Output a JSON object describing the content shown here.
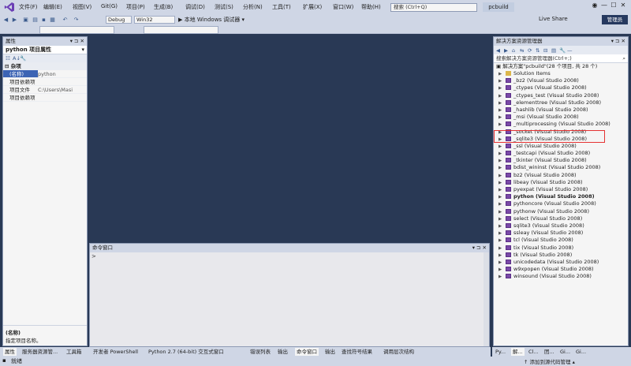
{
  "menubar": {
    "items": [
      "文件(F)",
      "编辑(E)",
      "视图(V)",
      "Git(G)",
      "项目(P)",
      "生成(B)",
      "调试(D)",
      "测试(S)",
      "分析(N)",
      "工具(T)",
      "扩展(X)",
      "窗口(W)",
      "帮助(H)"
    ],
    "search_placeholder": "搜索 (Ctrl+Q)",
    "solution_name": "pcbuild"
  },
  "toolbar": {
    "config": "Debug",
    "platform": "Win32",
    "run_label": "▶ 本地 Windows 调试器 ▾",
    "live_share": "Live Share",
    "admin_badge": "管理员"
  },
  "properties": {
    "title": "属性",
    "object": "python 项目属性",
    "category": "杂项",
    "rows": [
      {
        "key": "(名称)",
        "value": "python"
      },
      {
        "key": "项目依赖项",
        "value": ""
      },
      {
        "key": "项目文件",
        "value": "C:\\Users\\Masi"
      },
      {
        "key": "项目依赖项",
        "value": ""
      }
    ],
    "desc_title": "(名称)",
    "desc_text": "指定项目名称。"
  },
  "command_window": {
    "title": "命令窗口",
    "caret": ">"
  },
  "solution_explorer": {
    "title": "解决方案资源管理器",
    "search_placeholder": "搜索解决方案资源管理器(Ctrl+;)",
    "root": "解决方案\"pcbuild\"(28 个项目, 共 28 个)",
    "items": [
      {
        "label": "Solution Items",
        "kind": "folder",
        "bold": false
      },
      {
        "label": "_bz2 (Visual Studio 2008)",
        "kind": "project",
        "bold": false
      },
      {
        "label": "_ctypes (Visual Studio 2008)",
        "kind": "project",
        "bold": false
      },
      {
        "label": "_ctypes_test (Visual Studio 2008)",
        "kind": "project",
        "bold": false
      },
      {
        "label": "_elementtree (Visual Studio 2008)",
        "kind": "project",
        "bold": false
      },
      {
        "label": "_hashlib (Visual Studio 2008)",
        "kind": "project",
        "bold": false
      },
      {
        "label": "_msi (Visual Studio 2008)",
        "kind": "project",
        "bold": false
      },
      {
        "label": "_multiprocessing (Visual Studio 2008)",
        "kind": "project",
        "bold": false
      },
      {
        "label": "_socket (Visual Studio 2008)",
        "kind": "project",
        "bold": false
      },
      {
        "label": "_sqlite3 (Visual Studio 2008)",
        "kind": "project",
        "bold": false
      },
      {
        "label": "_ssl (Visual Studio 2008)",
        "kind": "project",
        "bold": false
      },
      {
        "label": "_testcapi (Visual Studio 2008)",
        "kind": "project",
        "bold": false
      },
      {
        "label": "_tkinter (Visual Studio 2008)",
        "kind": "project",
        "bold": false
      },
      {
        "label": "bdist_wininst (Visual Studio 2008)",
        "kind": "project",
        "bold": false
      },
      {
        "label": "bz2 (Visual Studio 2008)",
        "kind": "project",
        "bold": false
      },
      {
        "label": "libeay (Visual Studio 2008)",
        "kind": "project",
        "bold": false
      },
      {
        "label": "pyexpat (Visual Studio 2008)",
        "kind": "project",
        "bold": false
      },
      {
        "label": "python (Visual Studio 2008)",
        "kind": "project",
        "bold": true
      },
      {
        "label": "pythoncore (Visual Studio 2008)",
        "kind": "project",
        "bold": false
      },
      {
        "label": "pythonw (Visual Studio 2008)",
        "kind": "project",
        "bold": false
      },
      {
        "label": "select (Visual Studio 2008)",
        "kind": "project",
        "bold": false
      },
      {
        "label": "sqlite3 (Visual Studio 2008)",
        "kind": "project",
        "bold": false
      },
      {
        "label": "ssleay (Visual Studio 2008)",
        "kind": "project",
        "bold": false
      },
      {
        "label": "tcl (Visual Studio 2008)",
        "kind": "project",
        "bold": false
      },
      {
        "label": "tix (Visual Studio 2008)",
        "kind": "project",
        "bold": false
      },
      {
        "label": "tk (Visual Studio 2008)",
        "kind": "project",
        "bold": false
      },
      {
        "label": "unicodedata (Visual Studio 2008)",
        "kind": "project",
        "bold": false
      },
      {
        "label": "w9xpopen (Visual Studio 2008)",
        "kind": "project",
        "bold": false
      },
      {
        "label": "winsound (Visual Studio 2008)",
        "kind": "project",
        "bold": false
      }
    ]
  },
  "bottom_tabs": [
    "属性",
    "服务器资源管...",
    "工具箱",
    "开发者 PowerShell",
    "Python 2.7 (64-bit) 交互式窗口",
    "错误列表",
    "输出",
    "命令窗口",
    "输出",
    "查找符号结果",
    "调用层次结构"
  ],
  "sol_tabs": [
    "Py...",
    "解...",
    "Cl...",
    "团...",
    "Gi...",
    "Gi..."
  ],
  "statusbar": {
    "text": "就绪",
    "right": "↑ 添加到源代码管理 ▴"
  }
}
